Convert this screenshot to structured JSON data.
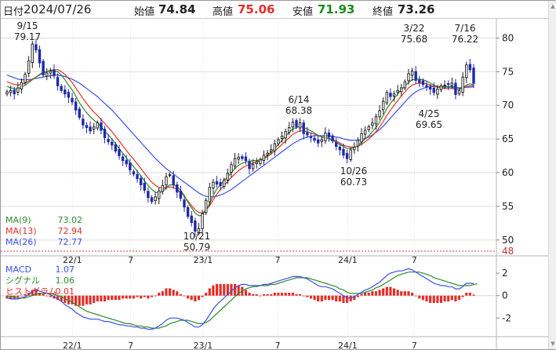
{
  "header": {
    "date_label": "日付",
    "date_value": "2024/07/26",
    "open_label": "始値",
    "open_value": "74.84",
    "high_label": "高値",
    "high_value": "75.06",
    "low_label": "安値",
    "low_value": "71.93",
    "close_label": "終値",
    "close_value": "73.26"
  },
  "colors": {
    "up": "#1a1a1a",
    "down": "#1f2aa8",
    "ma9": "#2e8b2e",
    "ma13": "#e0302a",
    "ma26": "#3c50e6",
    "macd": "#3c50e6",
    "signal": "#2e8b2e",
    "hist": "#e0302a",
    "high_value": "#e0302a",
    "low_value": "#1a8a1a"
  },
  "chart_data": [
    {
      "type": "candlestick",
      "title": "",
      "x_ticks": [
        "22/1",
        "7",
        "23/1",
        "7",
        "24/1",
        "7"
      ],
      "y_ticks": [
        80,
        75,
        70,
        65,
        60,
        55,
        50
      ],
      "y_axis_min_label": "48",
      "ylim": [
        48,
        82.5
      ],
      "grid": true,
      "legend": [
        {
          "name": "MA(9)",
          "value": "73.02"
        },
        {
          "name": "MA(13)",
          "value": "72.94"
        },
        {
          "name": "MA(26)",
          "value": "72.77"
        }
      ],
      "annotations": [
        {
          "date": "9/15",
          "value": "79.17"
        },
        {
          "date": "6/14",
          "value": "68.38"
        },
        {
          "date": "3/22",
          "value": "75.68"
        },
        {
          "date": "7/16",
          "value": "76.22"
        },
        {
          "date": "4/25",
          "value": "69.65"
        },
        {
          "date": "10/26",
          "value": "60.73"
        },
        {
          "date": "10/21",
          "value": "50.79"
        }
      ],
      "closes": [
        72.0,
        72.2,
        71.7,
        72.6,
        73.4,
        74.6,
        76.6,
        79.1,
        78.2,
        76.3,
        74.5,
        74.8,
        75.1,
        74.4,
        72.9,
        72.2,
        71.7,
        71.2,
        70.5,
        69.3,
        68.2,
        67.1,
        66.7,
        66.2,
        66.8,
        67.4,
        66.3,
        65.2,
        64.6,
        64.1,
        63.2,
        62.5,
        61.8,
        61.3,
        60.4,
        59.8,
        59.1,
        58.2,
        57.4,
        56.3,
        55.7,
        56.4,
        57.3,
        58.1,
        59.4,
        59.7,
        58.2,
        57.1,
        56.2,
        54.9,
        53.5,
        52.6,
        51.3,
        51.7,
        53.9,
        55.9,
        57.8,
        58.6,
        58.3,
        58.1,
        58.9,
        59.9,
        61.2,
        62.1,
        62.3,
        62.1,
        61.8,
        60.6,
        61.2,
        61.6,
        61.9,
        62.6,
        62.9,
        63.4,
        64.3,
        64.9,
        65.4,
        66.1,
        66.7,
        67.5,
        66.8,
        67.4,
        65.8,
        65.6,
        65.2,
        64.8,
        64.4,
        64.9,
        65.9,
        65.3,
        64.7,
        63.9,
        63.4,
        62.6,
        62.1,
        63.4,
        63.8,
        64.8,
        65.8,
        66.3,
        66.8,
        67.4,
        68.3,
        69.2,
        70.6,
        71.9,
        71.3,
        71.7,
        72.2,
        72.6,
        73.5,
        74.7,
        75.1,
        73.7,
        73.4,
        73.1,
        72.7,
        72.4,
        71.9,
        72.4,
        72.9,
        73.0,
        73.1,
        73.3,
        71.6,
        72.2,
        74.2,
        76.0,
        75.3,
        73.26
      ],
      "ma9": [
        72.8,
        72.6,
        72.5,
        72.4,
        72.7,
        73.0,
        73.4,
        73.8,
        74.2,
        74.6,
        74.9,
        75.0,
        75.2,
        75.1,
        75.0,
        74.5,
        73.8,
        73.0,
        72.3,
        71.4,
        70.4,
        69.6,
        68.9,
        68.3,
        67.8,
        67.4,
        66.8,
        66.2,
        65.6,
        65.0,
        64.3,
        63.6,
        62.9,
        62.2,
        61.5,
        60.9,
        60.2,
        59.5,
        58.8,
        58.1,
        57.5,
        57.1,
        57.0,
        57.2,
        57.8,
        58.2,
        58.2,
        57.9,
        57.4,
        56.6,
        55.6,
        54.8,
        54.0,
        53.6,
        53.7,
        54.4,
        55.4,
        56.6,
        57.6,
        58.2,
        58.8,
        59.4,
        60.0,
        60.6,
        61.1,
        61.4,
        61.6,
        61.7,
        61.8,
        61.8,
        61.9,
        62.2,
        62.6,
        63.1,
        63.6,
        64.2,
        64.8,
        65.4,
        66.0,
        66.5,
        66.7,
        66.9,
        66.7,
        66.5,
        66.2,
        65.9,
        65.5,
        65.3,
        65.2,
        65.0,
        64.8,
        64.5,
        64.2,
        63.9,
        63.6,
        63.6,
        63.7,
        64.0,
        64.5,
        65.0,
        65.5,
        66.1,
        66.7,
        67.5,
        68.5,
        69.5,
        70.3,
        71.0,
        71.7,
        72.3,
        72.9,
        73.4,
        73.8,
        73.9,
        73.9,
        73.8,
        73.6,
        73.3,
        73.0,
        72.8,
        72.7,
        72.7,
        72.7,
        72.7,
        72.5,
        72.4,
        72.6,
        73.0,
        73.2,
        73.02
      ],
      "ma13": [
        73.5,
        73.3,
        73.1,
        73.0,
        73.1,
        73.3,
        73.6,
        73.9,
        74.2,
        74.5,
        74.8,
        75.0,
        75.2,
        75.3,
        75.3,
        75.0,
        74.6,
        74.0,
        73.4,
        72.6,
        71.8,
        71.0,
        70.3,
        69.6,
        69.0,
        68.5,
        67.9,
        67.3,
        66.7,
        66.1,
        65.4,
        64.7,
        64.0,
        63.3,
        62.6,
        62.0,
        61.3,
        60.6,
        59.9,
        59.2,
        58.6,
        58.1,
        57.8,
        57.7,
        57.8,
        57.9,
        57.8,
        57.5,
        57.1,
        56.5,
        55.8,
        55.1,
        54.5,
        54.1,
        54.0,
        54.4,
        55.1,
        56.0,
        56.8,
        57.5,
        58.1,
        58.7,
        59.3,
        59.8,
        60.3,
        60.7,
        61.0,
        61.2,
        61.4,
        61.6,
        61.8,
        62.1,
        62.4,
        62.8,
        63.2,
        63.7,
        64.2,
        64.7,
        65.2,
        65.7,
        66.0,
        66.2,
        66.2,
        66.1,
        65.9,
        65.7,
        65.5,
        65.3,
        65.2,
        65.1,
        64.9,
        64.7,
        64.4,
        64.1,
        63.9,
        63.8,
        63.8,
        63.9,
        64.2,
        64.6,
        65.0,
        65.5,
        66.1,
        66.8,
        67.6,
        68.5,
        69.3,
        70.0,
        70.7,
        71.4,
        72.0,
        72.6,
        73.0,
        73.2,
        73.3,
        73.3,
        73.2,
        73.0,
        72.8,
        72.7,
        72.6,
        72.5,
        72.5,
        72.5,
        72.4,
        72.4,
        72.5,
        72.8,
        72.9,
        72.94
      ],
      "ma26": [
        74.5,
        74.3,
        74.1,
        73.9,
        73.8,
        73.8,
        73.8,
        73.9,
        74.0,
        74.1,
        74.2,
        74.3,
        74.4,
        74.5,
        74.5,
        74.4,
        74.3,
        74.1,
        73.9,
        73.6,
        73.3,
        72.9,
        72.5,
        72.1,
        71.7,
        71.3,
        70.8,
        70.3,
        69.8,
        69.3,
        68.7,
        68.1,
        67.5,
        66.9,
        66.3,
        65.7,
        65.1,
        64.5,
        63.9,
        63.3,
        62.7,
        62.1,
        61.6,
        61.1,
        60.6,
        60.2,
        59.8,
        59.4,
        59.0,
        58.6,
        58.2,
        57.8,
        57.4,
        57.0,
        56.7,
        56.5,
        56.4,
        56.4,
        56.5,
        56.7,
        56.9,
        57.2,
        57.5,
        57.9,
        58.3,
        58.7,
        59.1,
        59.5,
        59.9,
        60.3,
        60.7,
        61.1,
        61.5,
        61.9,
        62.3,
        62.7,
        63.1,
        63.5,
        63.9,
        64.3,
        64.6,
        64.9,
        65.1,
        65.3,
        65.4,
        65.5,
        65.5,
        65.5,
        65.5,
        65.5,
        65.4,
        65.3,
        65.2,
        65.0,
        64.9,
        64.8,
        64.8,
        64.8,
        64.9,
        65.1,
        65.3,
        65.6,
        66.0,
        66.4,
        66.9,
        67.5,
        68.1,
        68.7,
        69.3,
        69.9,
        70.5,
        71.1,
        71.6,
        72.0,
        72.3,
        72.5,
        72.7,
        72.8,
        72.8,
        72.8,
        72.8,
        72.8,
        72.8,
        72.8,
        72.7,
        72.6,
        72.6,
        72.7,
        72.7,
        72.77
      ]
    },
    {
      "type": "macd",
      "legend": [
        {
          "name": "MACD",
          "value": "1.07"
        },
        {
          "name": "シグナル",
          "value": "1.06"
        },
        {
          "name": "ヒストグラム",
          "value": "0.01"
        }
      ],
      "x_ticks": [
        "22/1",
        "7",
        "23/1",
        "7",
        "24/1",
        "7"
      ],
      "y_ticks": [
        2,
        0,
        -2
      ],
      "ylim": [
        -3.1,
        3.2
      ],
      "macd": [
        -0.2,
        -0.3,
        -0.3,
        -0.3,
        -0.2,
        -0.1,
        0.1,
        0.4,
        0.5,
        0.4,
        0.3,
        0.2,
        0.1,
        -0.1,
        -0.3,
        -0.5,
        -0.8,
        -1.0,
        -1.2,
        -1.5,
        -1.7,
        -1.9,
        -2.0,
        -2.1,
        -2.1,
        -2.1,
        -2.2,
        -2.3,
        -2.3,
        -2.4,
        -2.5,
        -2.6,
        -2.6,
        -2.7,
        -2.7,
        -2.8,
        -2.8,
        -2.9,
        -2.9,
        -3.0,
        -3.0,
        -2.9,
        -2.7,
        -2.5,
        -2.2,
        -2.0,
        -2.0,
        -2.0,
        -2.1,
        -2.2,
        -2.4,
        -2.6,
        -2.8,
        -2.8,
        -2.6,
        -2.2,
        -1.7,
        -1.2,
        -0.8,
        -0.5,
        -0.2,
        0.1,
        0.4,
        0.7,
        0.9,
        1.0,
        1.0,
        0.9,
        0.9,
        0.9,
        0.9,
        1.0,
        1.0,
        1.1,
        1.2,
        1.3,
        1.4,
        1.5,
        1.6,
        1.7,
        1.7,
        1.7,
        1.6,
        1.5,
        1.3,
        1.1,
        0.9,
        0.8,
        0.8,
        0.7,
        0.6,
        0.4,
        0.2,
        0.0,
        -0.2,
        -0.2,
        -0.1,
        0.1,
        0.3,
        0.5,
        0.6,
        0.8,
        1.0,
        1.2,
        1.5,
        1.8,
        2.0,
        2.1,
        2.2,
        2.2,
        2.3,
        2.4,
        2.3,
        2.1,
        1.9,
        1.7,
        1.5,
        1.3,
        1.1,
        1.0,
        0.9,
        0.9,
        0.8,
        0.8,
        0.6,
        0.6,
        0.8,
        1.1,
        1.1,
        1.07
      ],
      "signal": [
        0.0,
        -0.1,
        -0.1,
        -0.2,
        -0.2,
        -0.2,
        -0.1,
        0.0,
        0.1,
        0.2,
        0.2,
        0.2,
        0.2,
        0.1,
        0.0,
        -0.1,
        -0.3,
        -0.4,
        -0.6,
        -0.8,
        -1.0,
        -1.2,
        -1.4,
        -1.5,
        -1.6,
        -1.7,
        -1.8,
        -1.9,
        -2.0,
        -2.1,
        -2.2,
        -2.3,
        -2.4,
        -2.5,
        -2.5,
        -2.6,
        -2.7,
        -2.7,
        -2.8,
        -2.8,
        -2.9,
        -2.9,
        -2.9,
        -2.8,
        -2.7,
        -2.5,
        -2.4,
        -2.3,
        -2.2,
        -2.2,
        -2.2,
        -2.3,
        -2.4,
        -2.5,
        -2.5,
        -2.4,
        -2.2,
        -1.9,
        -1.6,
        -1.3,
        -1.0,
        -0.7,
        -0.4,
        -0.1,
        0.2,
        0.4,
        0.6,
        0.7,
        0.8,
        0.8,
        0.9,
        0.9,
        0.9,
        1.0,
        1.0,
        1.1,
        1.2,
        1.3,
        1.4,
        1.5,
        1.6,
        1.6,
        1.6,
        1.6,
        1.5,
        1.4,
        1.3,
        1.2,
        1.1,
        1.0,
        0.9,
        0.8,
        0.6,
        0.5,
        0.3,
        0.2,
        0.2,
        0.2,
        0.2,
        0.3,
        0.4,
        0.5,
        0.7,
        0.8,
        1.0,
        1.2,
        1.4,
        1.6,
        1.8,
        1.9,
        2.0,
        2.1,
        2.1,
        2.1,
        2.1,
        2.0,
        1.9,
        1.8,
        1.6,
        1.5,
        1.4,
        1.3,
        1.2,
        1.1,
        1.0,
        0.9,
        0.9,
        0.9,
        0.9,
        1.0,
        1.06
      ]
    }
  ]
}
